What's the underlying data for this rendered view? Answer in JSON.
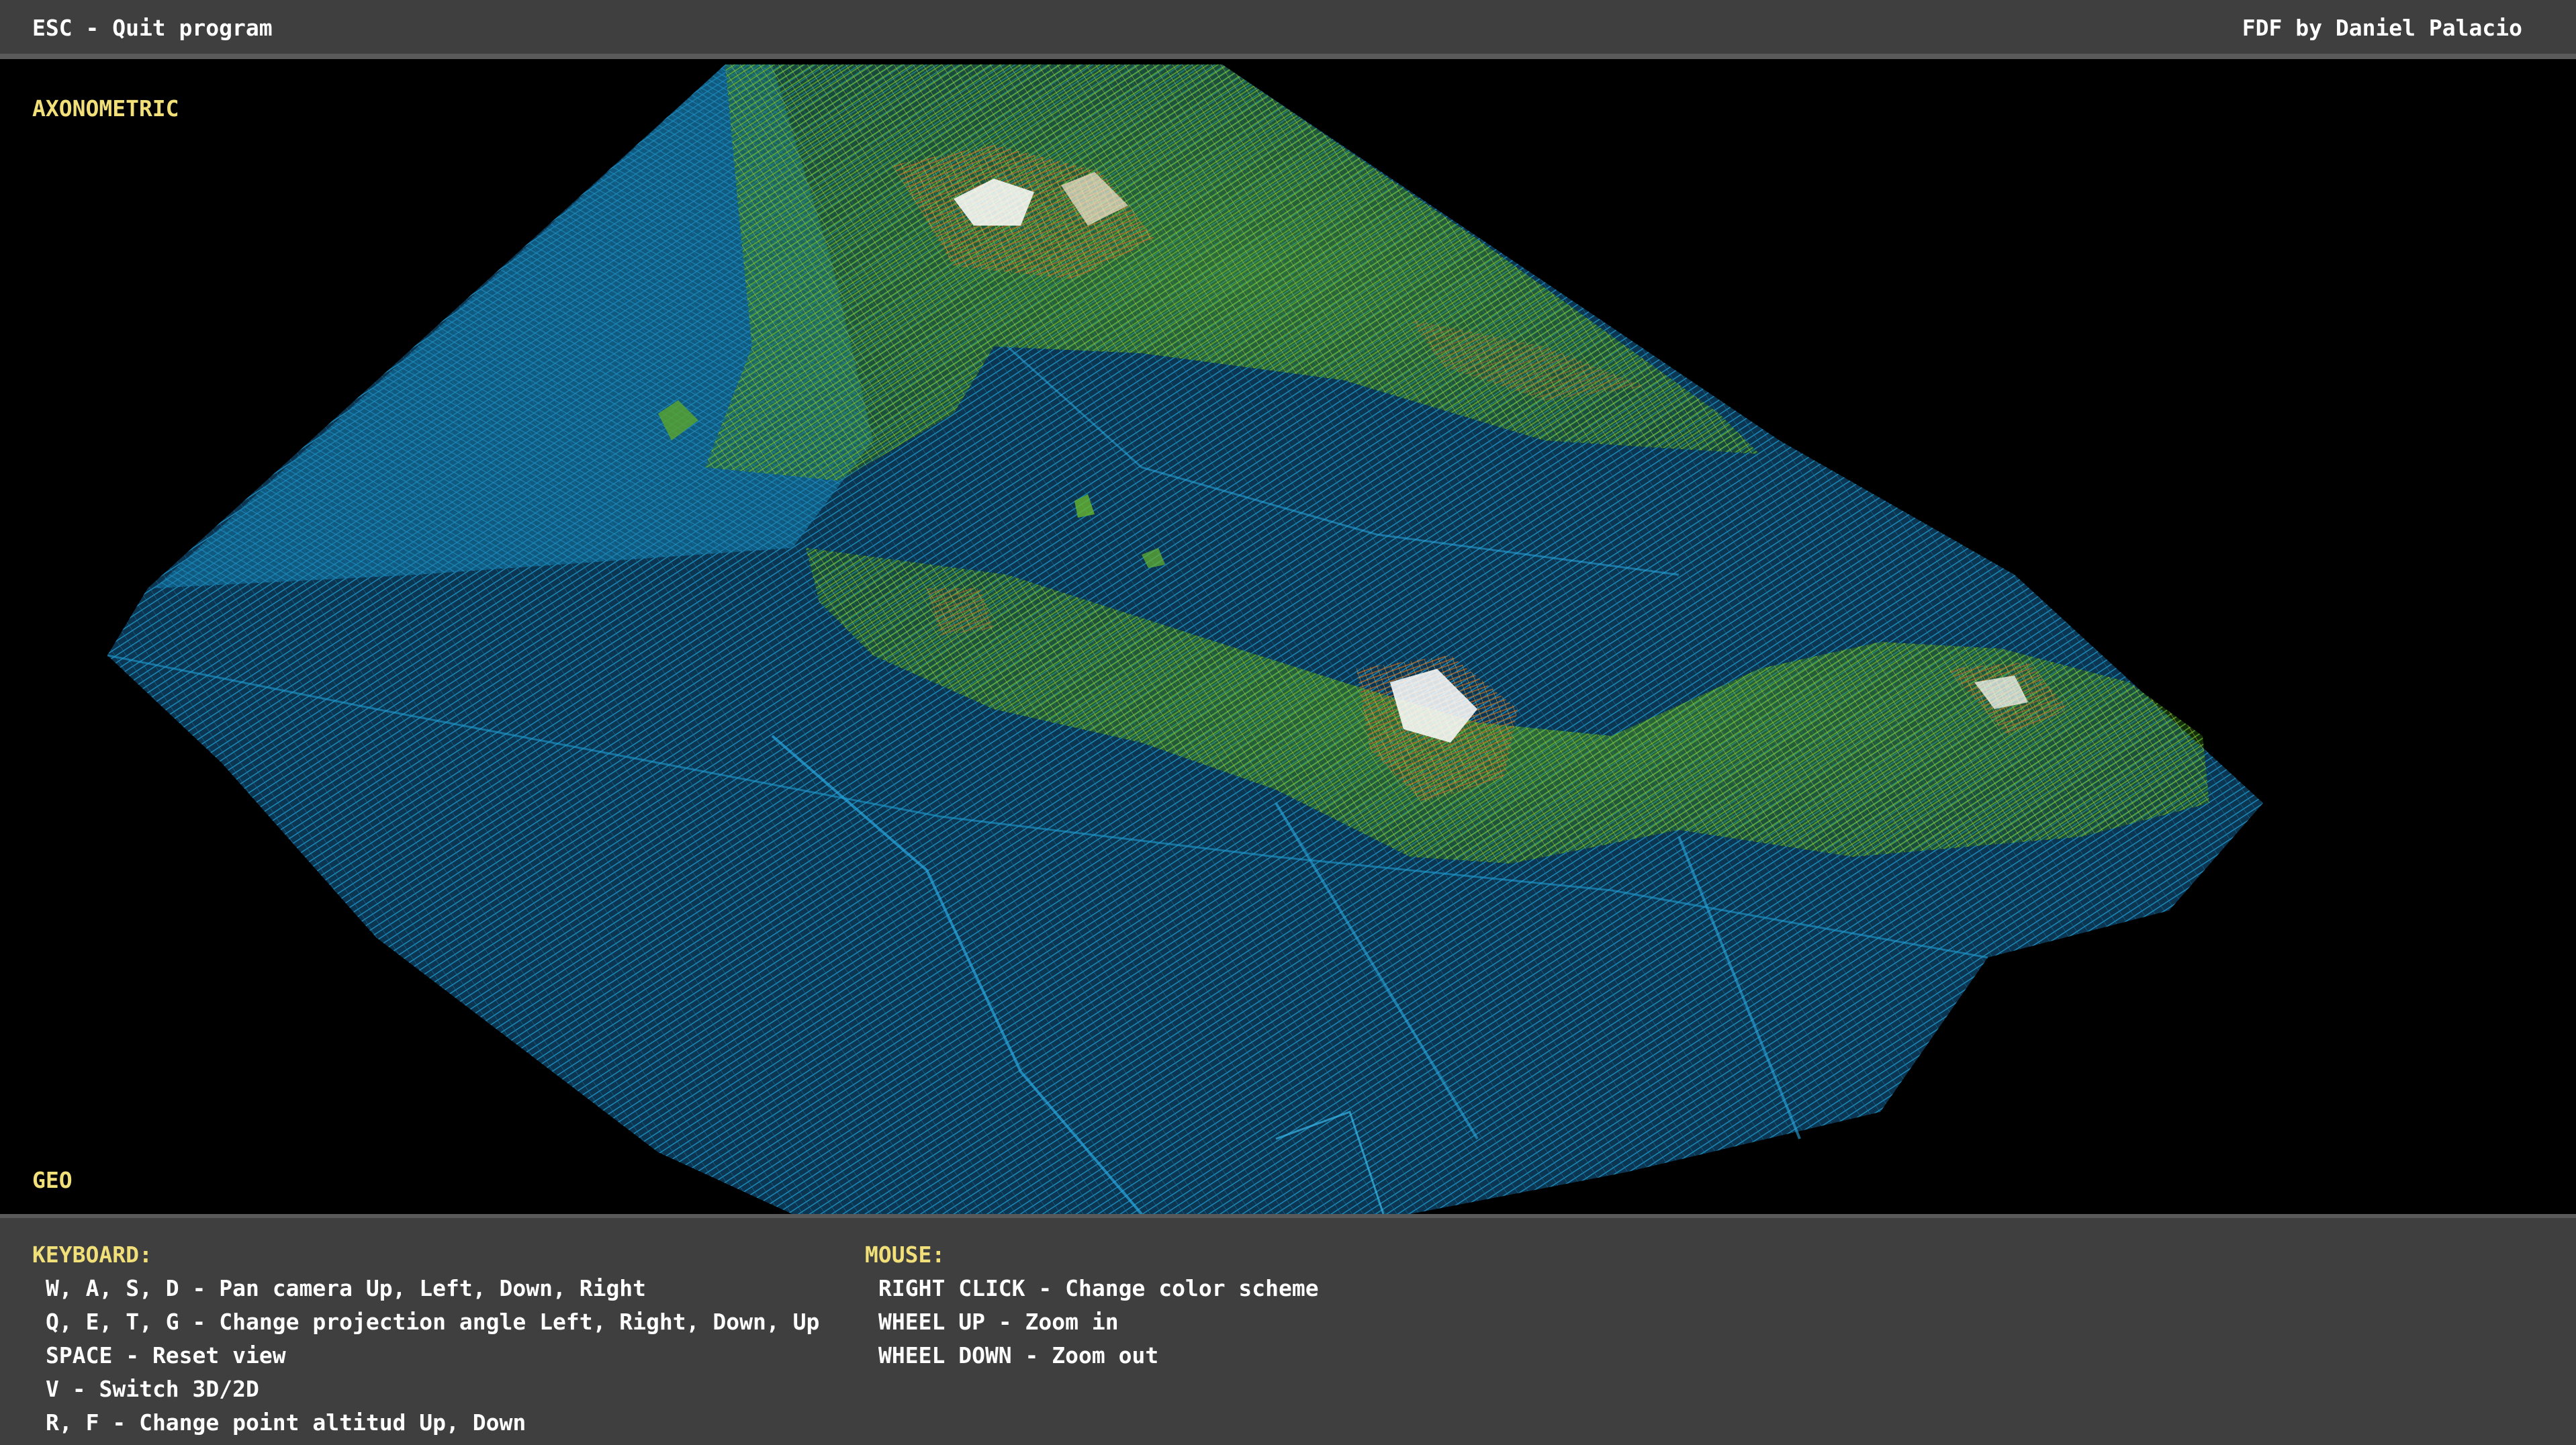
{
  "header": {
    "quit_hint": "ESC - Quit program",
    "credit": "FDF by Daniel Palacio"
  },
  "view": {
    "projection": "AXONOMETRIC",
    "mode": "GEO"
  },
  "colors": {
    "bar_bg": "#3f3f3f",
    "label_yellow": "#f1e079",
    "water": "#1b8fc4",
    "land_green": "#5aa52a",
    "land_yellow": "#d9d84a",
    "land_brown": "#a0602a",
    "peak_white": "#ffffff"
  },
  "controls": {
    "keyboard": {
      "title": "KEYBOARD:",
      "items": [
        "W, A, S, D - Pan camera Up, Left, Down, Right",
        "Q, E, T, G - Change projection angle Left, Right, Down, Up",
        "SPACE - Reset view",
        "V - Switch 3D/2D",
        "R, F - Change point altitud Up, Down"
      ]
    },
    "mouse": {
      "title": "MOUSE:",
      "items": [
        "RIGHT CLICK - Change color scheme",
        "WHEEL UP - Zoom in",
        "WHEEL DOWN - Zoom out"
      ]
    }
  }
}
